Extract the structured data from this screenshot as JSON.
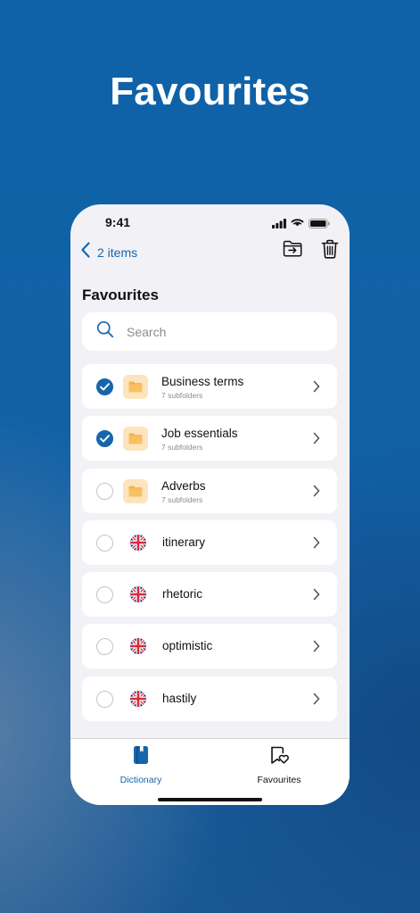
{
  "hero": {
    "title": "Favourites"
  },
  "status_bar": {
    "time": "9:41"
  },
  "nav": {
    "back_label": "2 items"
  },
  "section": {
    "title": "Favourites"
  },
  "search": {
    "placeholder": "Search"
  },
  "list": {
    "folders": [
      {
        "title": "Business terms",
        "subtitle": "7 subfolders",
        "selected": true
      },
      {
        "title": "Job essentials",
        "subtitle": "7 subfolders",
        "selected": true
      },
      {
        "title": "Adverbs",
        "subtitle": "7 subfolders",
        "selected": false
      }
    ],
    "words": [
      {
        "title": "itinerary",
        "selected": false
      },
      {
        "title": "rhetoric",
        "selected": false
      },
      {
        "title": "optimistic",
        "selected": false
      },
      {
        "title": "hastily",
        "selected": false
      }
    ]
  },
  "tabs": [
    {
      "label": "Dictionary",
      "icon": "book-icon",
      "active": true
    },
    {
      "label": "Favourites",
      "icon": "heart-bookmark-icon",
      "active": false
    }
  ],
  "colors": {
    "accent": "#1766ac",
    "background": "#0f62a8",
    "folder_tile": "#fde4bf",
    "folder_icon": "#f6b24b"
  }
}
